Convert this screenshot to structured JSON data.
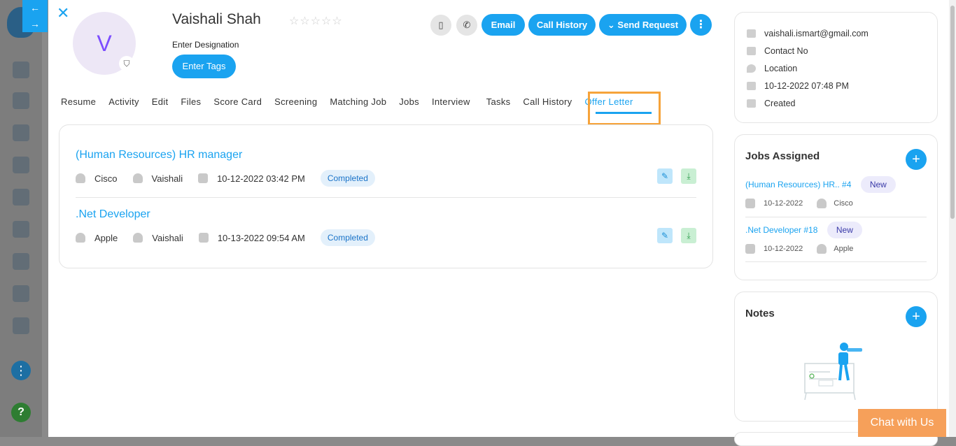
{
  "profile": {
    "initial": "V",
    "name": "Vaishali Shah",
    "stars": "☆☆☆☆☆",
    "designation": "Enter Designation",
    "tags_label": "Enter Tags"
  },
  "header_actions": {
    "email_label": "Email",
    "call_history_label": "Call History",
    "send_request_label": "Send Request"
  },
  "tabs": [
    "Resume",
    "Activity",
    "Edit",
    "Files",
    "Score Card",
    "Screening",
    "Matching Job",
    "Jobs",
    "Interview",
    "Tasks",
    "Call History",
    "Offer Letter"
  ],
  "active_tab": "Offer Letter",
  "offers": [
    {
      "title": "(Human Resources) HR manager",
      "company": "Cisco",
      "person": "Vaishali",
      "date": "10-12-2022 03:42 PM",
      "status": "Completed"
    },
    {
      "title": ".Net Developer",
      "company": "Apple",
      "person": "Vaishali",
      "date": "10-13-2022 09:54 AM",
      "status": "Completed"
    }
  ],
  "contact": {
    "email": "vaishali.ismart@gmail.com",
    "phone": "Contact No",
    "location": "Location",
    "created_date": "10-12-2022 07:48 PM",
    "created_label": "Created"
  },
  "jobs_assigned": {
    "title": "Jobs Assigned",
    "items": [
      {
        "title": "(Human Resources) HR.. #4",
        "badge": "New",
        "date": "10-12-2022",
        "company": "Cisco"
      },
      {
        "title": ".Net Developer #18",
        "badge": "New",
        "date": "10-12-2022",
        "company": "Apple"
      }
    ]
  },
  "notes": {
    "title": "Notes"
  },
  "chat": {
    "label": "Chat with Us"
  },
  "colors": {
    "accent": "#1aa3f0",
    "highlight": "#f6a33a",
    "chat": "#f6a05a"
  }
}
